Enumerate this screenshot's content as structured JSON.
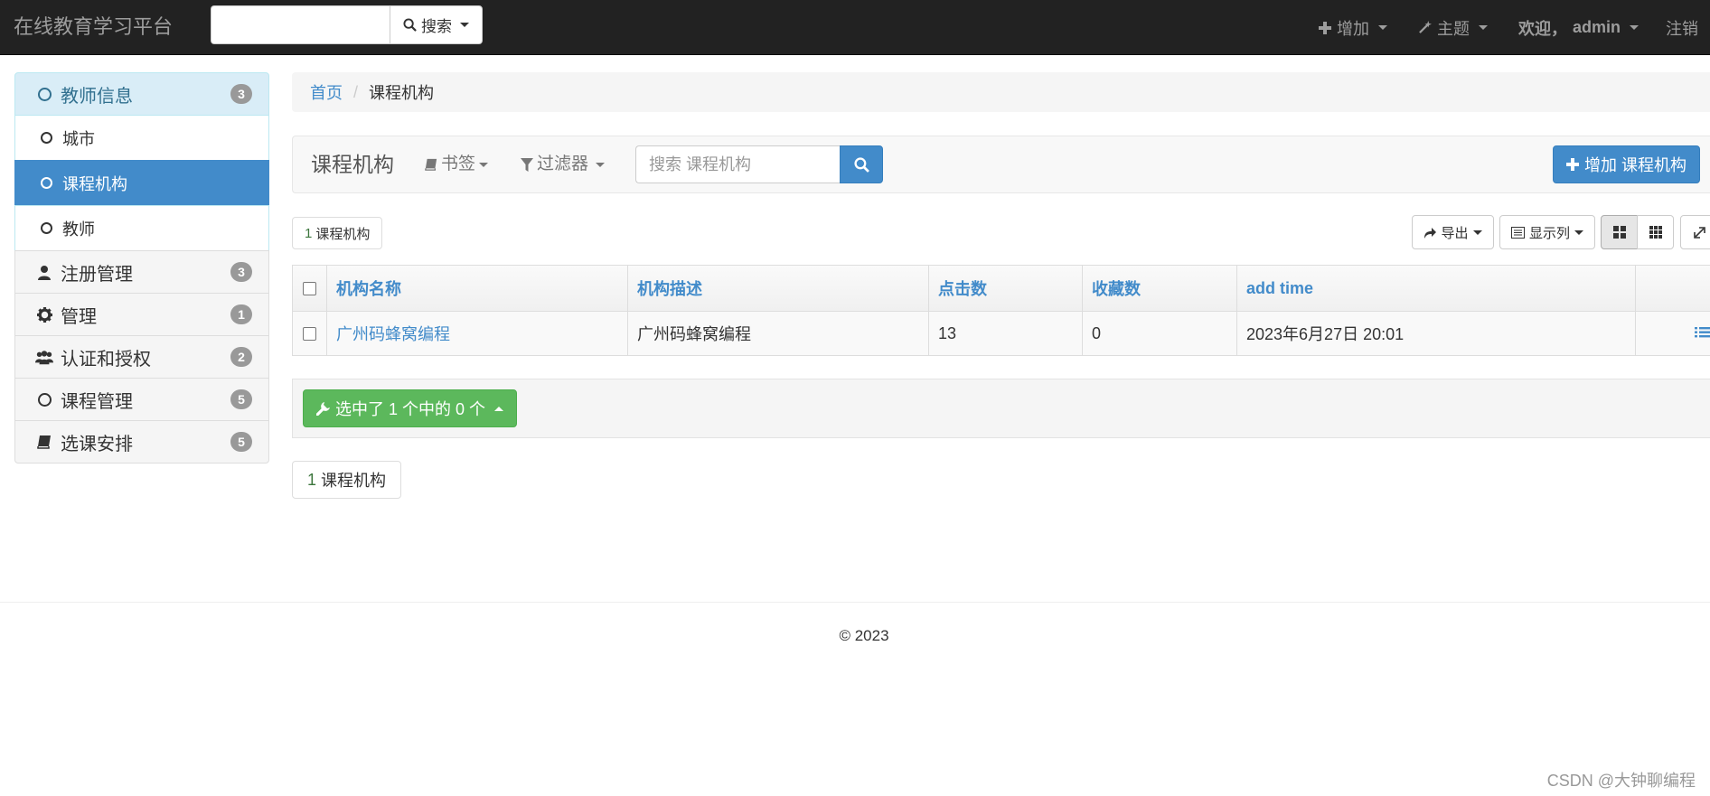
{
  "navbar": {
    "brand": "在线教育学习平台",
    "search_button": "搜索",
    "add_menu": "增加",
    "theme_menu": "主题",
    "welcome_prefix": "欢迎，",
    "username": "admin",
    "logout": "注销"
  },
  "sidebar": {
    "items": [
      {
        "label": "教师信息",
        "badge": "3",
        "icon": "circle-icon"
      },
      {
        "label": "城市",
        "icon": "circle-icon"
      },
      {
        "label": "课程机构",
        "icon": "circle-icon"
      },
      {
        "label": "教师",
        "icon": "circle-icon"
      },
      {
        "label": "注册管理",
        "badge": "3",
        "icon": "user-icon"
      },
      {
        "label": "管理",
        "badge": "1",
        "icon": "gear-icon"
      },
      {
        "label": "认证和授权",
        "badge": "2",
        "icon": "group-icon"
      },
      {
        "label": "课程管理",
        "badge": "5",
        "icon": "circle-icon"
      },
      {
        "label": "选课安排",
        "badge": "5",
        "icon": "book-icon"
      }
    ]
  },
  "breadcrumb": {
    "home": "首页",
    "current": "课程机构"
  },
  "toolbar": {
    "title": "课程机构",
    "bookmarks": "书签",
    "filters": "过滤器",
    "search_placeholder": "搜索 课程机构",
    "add_button": "增加 课程机构"
  },
  "result_count": {
    "number": "1",
    "label": "课程机构"
  },
  "view_controls": {
    "export": "导出",
    "columns": "显示列"
  },
  "table": {
    "headers": [
      "机构名称",
      "机构描述",
      "点击数",
      "收藏数",
      "add time"
    ],
    "rows": [
      {
        "name": "广州码蜂窝编程",
        "desc": "广州码蜂窝编程",
        "clicks": "13",
        "favs": "0",
        "add_time": "2023年6月27日 20:01"
      }
    ]
  },
  "actions": {
    "selected_label": "选中了 1 个中的 0 个"
  },
  "footer": {
    "copyright": "© 2023"
  },
  "watermark": "CSDN @大钟聊编程",
  "colors": {
    "primary": "#428bca",
    "success": "#5cb85c",
    "navbar": "#222222"
  }
}
